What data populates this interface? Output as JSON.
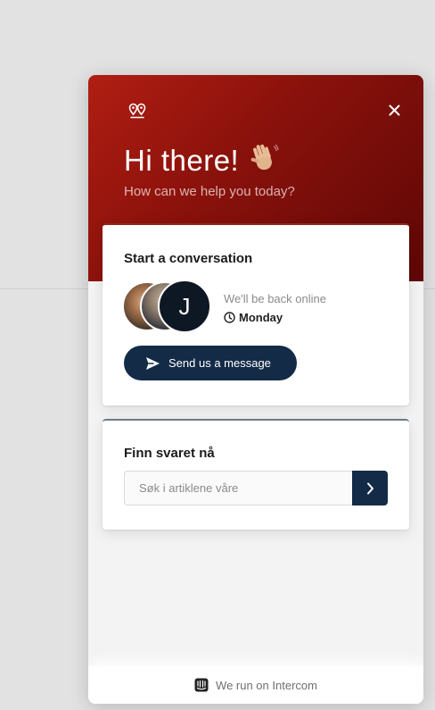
{
  "widget": {
    "greeting": "Hi there!",
    "greeting_emoji": "waving-hand-icon",
    "subtitle": "How can we help you today?",
    "colors": {
      "header_start": "#b01e12",
      "header_end": "#5e0706",
      "button": "#132b47"
    }
  },
  "conversation": {
    "title": "Start a conversation",
    "avatar_initial": "J",
    "status": "We'll be back online",
    "back_day": "Monday",
    "send_label": "Send us a message"
  },
  "search": {
    "title": "Finn svaret nå",
    "placeholder": "Søk i artiklene våre"
  },
  "footer": {
    "label": "We run on Intercom"
  }
}
